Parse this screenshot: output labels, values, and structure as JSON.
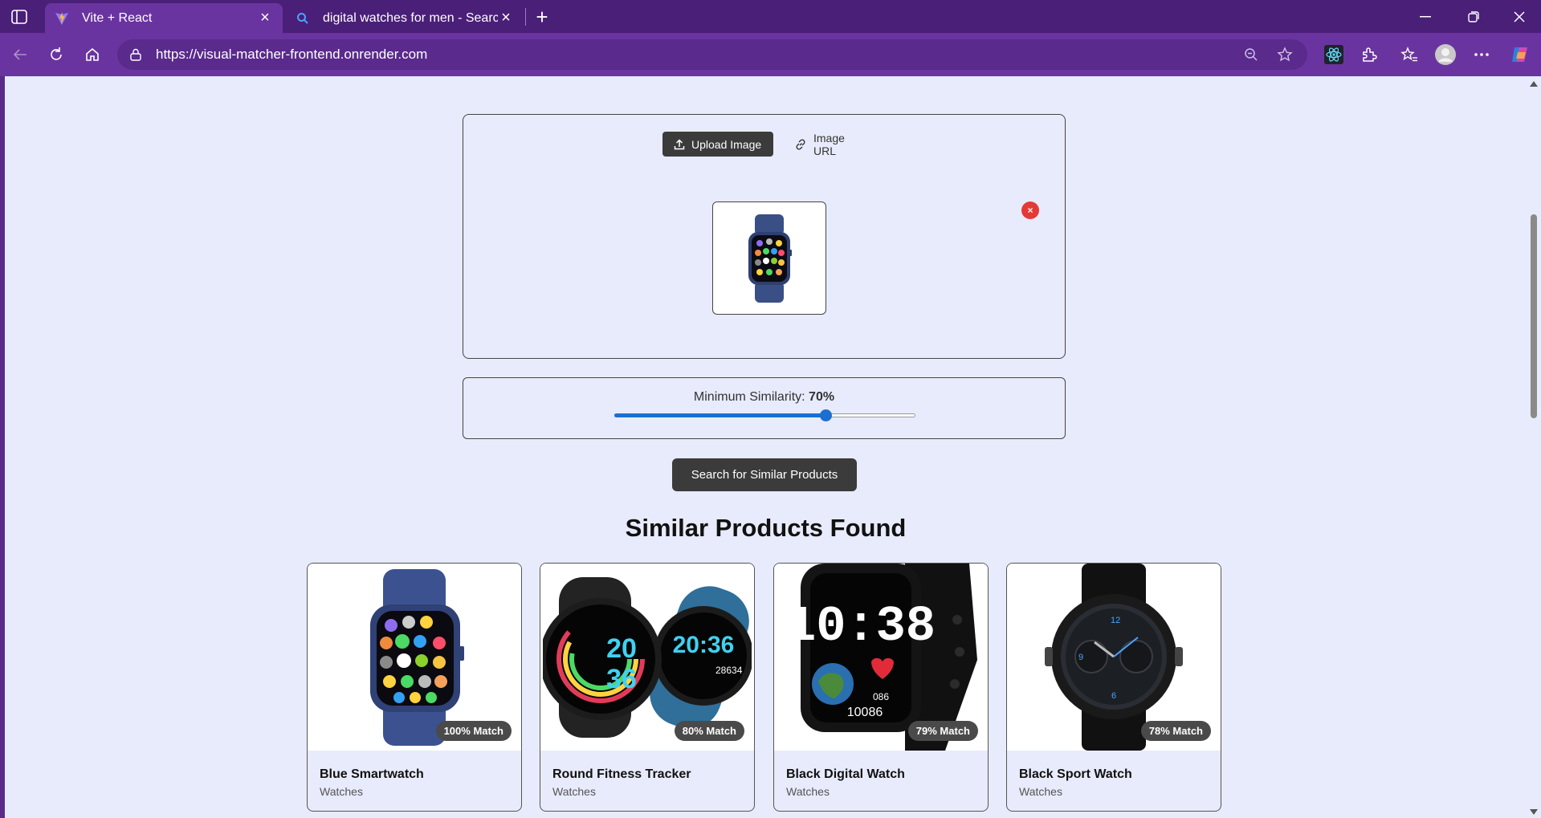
{
  "browser": {
    "tabs": [
      {
        "title": "Vite + React",
        "active": true,
        "icon": "vite-icon"
      },
      {
        "title": "digital watches for men - Search ",
        "active": false,
        "icon": "search-icon"
      }
    ],
    "url": "https://visual-matcher-frontend.onrender.com"
  },
  "upload": {
    "upload_label": "Upload Image",
    "url_label": "Image URL",
    "remove_label": "×"
  },
  "similarity": {
    "label": "Minimum Similarity:",
    "value_text": "70%",
    "value": 0.7
  },
  "search_button": "Search for Similar Products",
  "results": {
    "title": "Similar Products Found",
    "products": [
      {
        "name": "Blue Smartwatch",
        "category": "Watches",
        "match": "100% Match"
      },
      {
        "name": "Round Fitness Tracker",
        "category": "Watches",
        "match": "80% Match"
      },
      {
        "name": "Black Digital Watch",
        "category": "Watches",
        "match": "79% Match"
      },
      {
        "name": "Black Sport Watch",
        "category": "Watches",
        "match": "78% Match"
      }
    ]
  },
  "colors": {
    "browser_frame": "#6a34a0",
    "page_bg": "#e8ebfb",
    "accent": "#1a6fd1",
    "remove": "#e53935"
  }
}
